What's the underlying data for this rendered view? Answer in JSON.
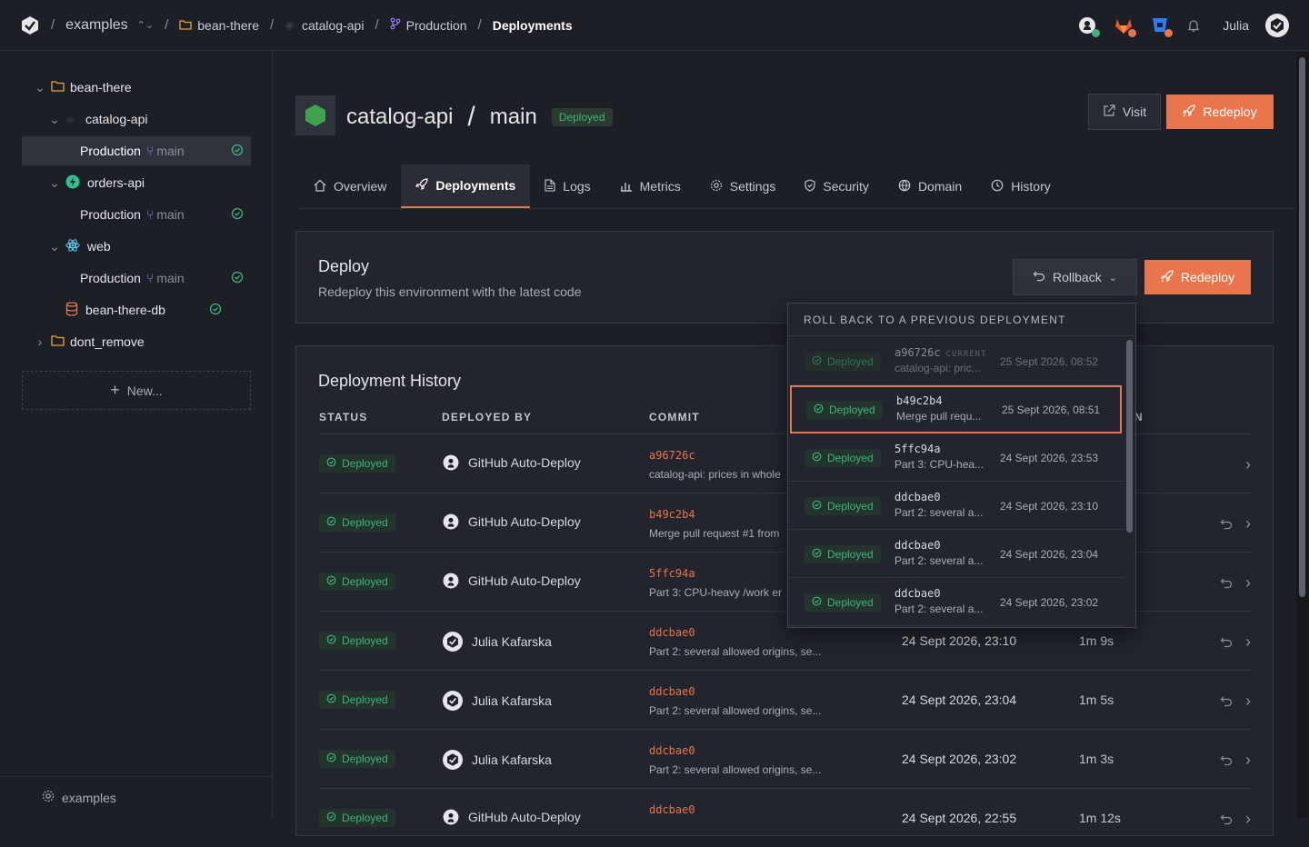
{
  "breadcrumb": {
    "org": "examples",
    "project": "bean-there",
    "service": "catalog-api",
    "environment": "Production",
    "page": "Deployments"
  },
  "user": {
    "name": "Julia"
  },
  "sidebar": {
    "items": [
      {
        "label": "bean-there",
        "type": "project"
      },
      {
        "label": "catalog-api",
        "type": "service"
      },
      {
        "label": "Production",
        "branch": "main",
        "selected": true
      },
      {
        "label": "orders-api",
        "type": "service"
      },
      {
        "label": "Production",
        "branch": "main"
      },
      {
        "label": "web",
        "type": "service"
      },
      {
        "label": "Production",
        "branch": "main"
      },
      {
        "label": "bean-there-db",
        "type": "database"
      },
      {
        "label": "dont_remove",
        "type": "project"
      }
    ],
    "new_label": "New...",
    "footer": "examples"
  },
  "header": {
    "service": "catalog-api",
    "slash": "/",
    "branch": "main",
    "status": "Deployed",
    "visit_label": "Visit",
    "redeploy_label": "Redeploy"
  },
  "tabs": [
    {
      "label": "Overview"
    },
    {
      "label": "Deployments",
      "active": true
    },
    {
      "label": "Logs"
    },
    {
      "label": "Metrics"
    },
    {
      "label": "Settings"
    },
    {
      "label": "Security"
    },
    {
      "label": "Domain"
    },
    {
      "label": "History"
    }
  ],
  "deploy_card": {
    "title": "Deploy",
    "subtitle": "Redeploy this environment with the latest code",
    "rollback_label": "Rollback",
    "redeploy_label": "Redeploy"
  },
  "history": {
    "title": "Deployment History",
    "columns": [
      "STATUS",
      "DEPLOYED BY",
      "COMMIT",
      "N"
    ],
    "rows": [
      {
        "status": "Deployed",
        "by": "GitHub Auto-Deploy",
        "avatar": "github",
        "sha": "a96726c",
        "msg": "catalog-api: prices in whole",
        "date": "",
        "duration": ""
      },
      {
        "status": "Deployed",
        "by": "GitHub Auto-Deploy",
        "avatar": "github",
        "sha": "b49c2b4",
        "msg": "Merge pull request #1 from",
        "date": "",
        "duration": ""
      },
      {
        "status": "Deployed",
        "by": "GitHub Auto-Deploy",
        "avatar": "github",
        "sha": "5ffc94a",
        "msg": "Part 3: CPU-heavy /work er",
        "date": "",
        "duration": ""
      },
      {
        "status": "Deployed",
        "by": "Julia Kafarska",
        "avatar": "user",
        "sha": "ddcbae0",
        "msg": "Part 2: several allowed origins, se...",
        "date": "24 Sept 2026, 23:10",
        "duration": "1m 9s"
      },
      {
        "status": "Deployed",
        "by": "Julia Kafarska",
        "avatar": "user",
        "sha": "ddcbae0",
        "msg": "Part 2: several allowed origins, se...",
        "date": "24 Sept 2026, 23:04",
        "duration": "1m 5s"
      },
      {
        "status": "Deployed",
        "by": "Julia Kafarska",
        "avatar": "user",
        "sha": "ddcbae0",
        "msg": "Part 2: several allowed origins, se...",
        "date": "24 Sept 2026, 23:02",
        "duration": "1m 3s"
      },
      {
        "status": "Deployed",
        "by": "GitHub Auto-Deploy",
        "avatar": "github",
        "sha": "ddcbae0",
        "msg": "",
        "date": "24 Sept 2026, 22:55",
        "duration": "1m 12s"
      }
    ]
  },
  "rollback_menu": {
    "header": "ROLL BACK TO A PREVIOUS DEPLOYMENT",
    "current_tag": "CURRENT",
    "items": [
      {
        "status": "Deployed",
        "sha": "a96726c",
        "msg": "catalog-api: pric...",
        "date": "25 Sept 2026, 08:52",
        "current": true
      },
      {
        "status": "Deployed",
        "sha": "b49c2b4",
        "msg": "Merge pull requ...",
        "date": "25 Sept 2026, 08:51",
        "highlighted": true
      },
      {
        "status": "Deployed",
        "sha": "5ffc94a",
        "msg": "Part 3: CPU-hea...",
        "date": "24 Sept 2026, 23:53"
      },
      {
        "status": "Deployed",
        "sha": "ddcbae0",
        "msg": "Part 2: several a...",
        "date": "24 Sept 2026, 23:10"
      },
      {
        "status": "Deployed",
        "sha": "ddcbae0",
        "msg": "Part 2: several a...",
        "date": "24 Sept 2026, 23:04"
      },
      {
        "status": "Deployed",
        "sha": "ddcbae0",
        "msg": "Part 2: several a...",
        "date": "24 Sept 2026, 23:02"
      }
    ]
  },
  "colors": {
    "accent": "#e8754b",
    "success": "#3fb37a",
    "background": "#1c1f26"
  }
}
